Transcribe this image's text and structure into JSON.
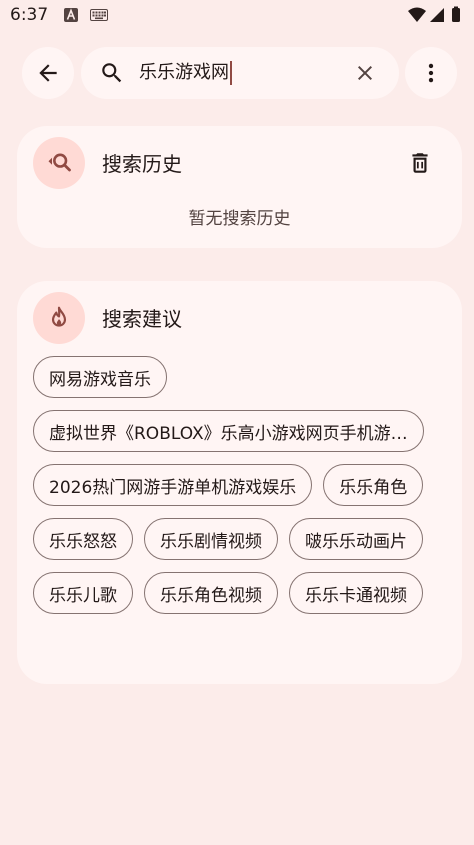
{
  "status_bar": {
    "time": "6:37"
  },
  "search": {
    "query": "乐乐游戏网"
  },
  "history": {
    "title": "搜索历史",
    "empty_text": "暂无搜索历史"
  },
  "suggestions": {
    "title": "搜索建议",
    "items": [
      "网易游戏音乐",
      "虚拟世界《ROBLOX》乐高小游戏网页手机游…",
      "2026热门网游手游单机游戏娱乐",
      "乐乐角色",
      "乐乐怒怒",
      "乐乐剧情视频",
      "啵乐乐动画片",
      "乐乐儿歌",
      "乐乐角色视频",
      "乐乐卡通视频"
    ]
  },
  "colors": {
    "background": "#FCECEA",
    "surface": "#FFF5F4",
    "icon_container": "#FFDAD5",
    "accent": "#904A43",
    "on_surface": "#231918"
  },
  "icons": {
    "back": "arrow-back-icon",
    "search": "search-icon",
    "clear": "close-icon",
    "more": "more-vert-icon",
    "history": "manage-search-icon",
    "delete": "delete-icon",
    "suggest": "fire-icon"
  }
}
